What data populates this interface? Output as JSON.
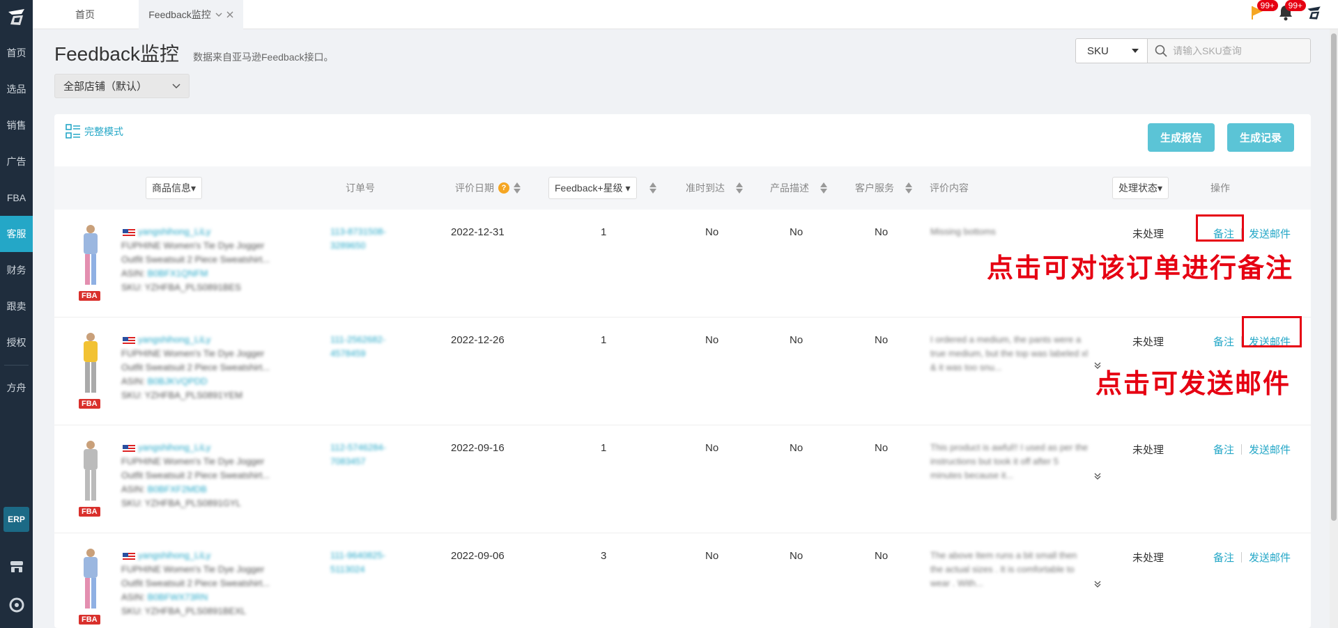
{
  "sidebar": {
    "items": [
      {
        "label": "首页"
      },
      {
        "label": "选品"
      },
      {
        "label": "销售"
      },
      {
        "label": "广告"
      },
      {
        "label": "FBA"
      },
      {
        "label": "客服"
      },
      {
        "label": "财务"
      },
      {
        "label": "跟卖"
      },
      {
        "label": "授权"
      },
      {
        "label": "方舟"
      }
    ],
    "erp": "ERP"
  },
  "tabs": {
    "home": "首页",
    "feedback": "Feedback监控"
  },
  "top": {
    "flag_badge": "99+",
    "bell_badge": "99+"
  },
  "header": {
    "title": "Feedback监控",
    "subtitle": "数据来自亚马逊Feedback接口。",
    "store_select": "全部店铺（默认）",
    "search_type": "SKU",
    "search_placeholder": "请输入SKU查询"
  },
  "toolbar": {
    "mode": "完整模式",
    "report": "生成报告",
    "record": "生成记录"
  },
  "columns": {
    "product": "商品信息▾",
    "order": "订单号",
    "date": "评价日期",
    "feedback": "Feedback+星级 ▾",
    "ontime": "准时到达",
    "desc": "产品描述",
    "service": "客户服务",
    "content": "评价内容",
    "status": "处理状态▾",
    "ops": "操作"
  },
  "rows": [
    {
      "store": "yangshihong_LiLy",
      "title1": "FUPHINE Women's Tie Dye Jogger",
      "title2": "Outfit Sweatsuit 2 Piece Sweatshirt...",
      "asin_label": "ASIN:",
      "asin": "B0BFX1QNFM",
      "sku": "SKU: YZHFBA_PLS0891BES",
      "order1": "113-8731508-",
      "order2": "3289650",
      "date": "2022-12-31",
      "rating": "1",
      "ontime": "No",
      "desc": "No",
      "service": "No",
      "review": "Missing bottoms",
      "status": "未处理",
      "note": "备注",
      "mail": "发送邮件",
      "fba": "FBA"
    },
    {
      "store": "yangshihong_LiLy",
      "title1": "FUPHINE Women's Tie Dye Jogger",
      "title2": "Outfit Sweatsuit 2 Piece Sweatshirt...",
      "asin_label": "ASIN:",
      "asin": "B0BJKVQPDD",
      "sku": "SKU: YZHFBA_PLS0891YEM",
      "order1": "111-2562682-",
      "order2": "4578459",
      "date": "2022-12-26",
      "rating": "1",
      "ontime": "No",
      "desc": "No",
      "service": "No",
      "review": "I ordered a medium, the pants were a true medium, but the top was labeled xl & it was too snu...",
      "status": "未处理",
      "note": "备注",
      "mail": "发送邮件",
      "fba": "FBA"
    },
    {
      "store": "yangshihong_LiLy",
      "title1": "FUPHINE Women's Tie Dye Jogger",
      "title2": "Outfit Sweatsuit 2 Piece Sweatshirt...",
      "asin_label": "ASIN:",
      "asin": "B0BFXF2MDB",
      "sku": "SKU: YZHFBA_PLS0891GYL",
      "order1": "112-5746284-",
      "order2": "7083457",
      "date": "2022-09-16",
      "rating": "1",
      "ontime": "No",
      "desc": "No",
      "service": "No",
      "review": "This product is awful!! I used as per the instructions but took it off after 5 minutes because it...",
      "status": "未处理",
      "note": "备注",
      "mail": "发送邮件",
      "fba": "FBA"
    },
    {
      "store": "yangshihong_LiLy",
      "title1": "FUPHINE Women's Tie Dye Jogger",
      "title2": "Outfit Sweatsuit 2 Piece Sweatshirt...",
      "asin_label": "ASIN:",
      "asin": "B0BFWX73RN",
      "sku": "SKU: YZHFBA_PLS0891BEXL",
      "order1": "111-9640825-",
      "order2": "5113024",
      "date": "2022-09-06",
      "rating": "3",
      "ontime": "No",
      "desc": "No",
      "service": "No",
      "review": "The above Item runs a bit small then the actual sizes . It is comfortable to wear . With...",
      "status": "未处理",
      "note": "备注",
      "mail": "发送邮件",
      "fba": "FBA"
    }
  ],
  "annotations": {
    "note_hint": "点击可对该订单进行备注",
    "mail_hint": "点击可发送邮件"
  },
  "colors": {
    "accent": "#24a7c7",
    "sidebar": "#1f2d3d",
    "annotation": "#e60012"
  }
}
